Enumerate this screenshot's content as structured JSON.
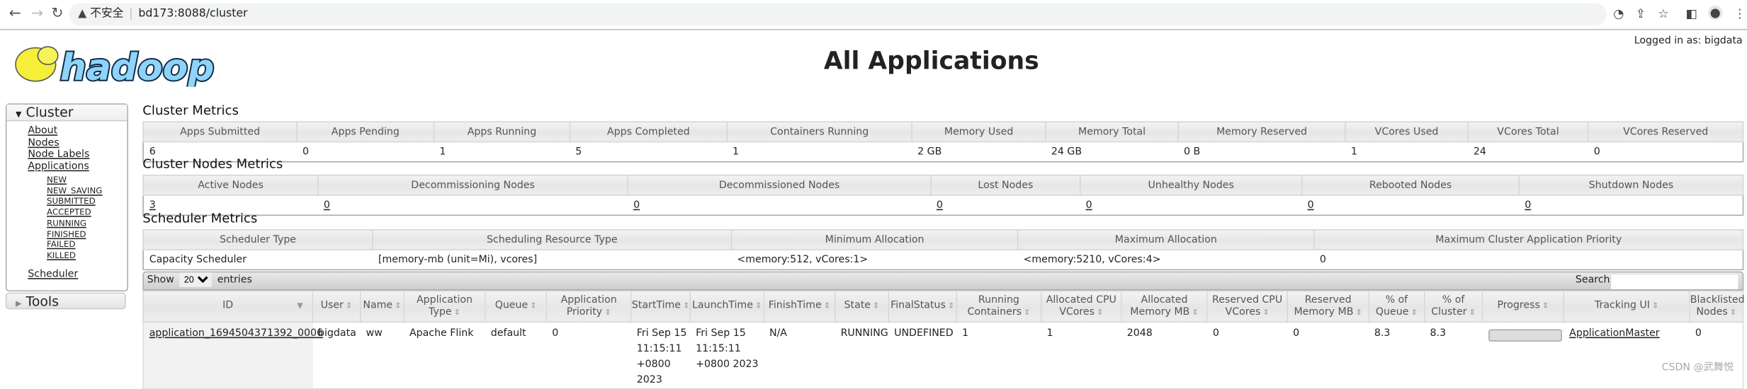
{
  "browser": {
    "security_label": "不安全",
    "url": "bd173:8088/cluster"
  },
  "header": {
    "logo_text": "hadoop",
    "title": "All Applications",
    "logged_in": "Logged in as: bigdata"
  },
  "sidebar": {
    "cluster_label": "Cluster",
    "links": [
      "About",
      "Nodes",
      "Node Labels",
      "Applications"
    ],
    "app_states": [
      "NEW",
      "NEW_SAVING",
      "SUBMITTED",
      "ACCEPTED",
      "RUNNING",
      "FINISHED",
      "FAILED",
      "KILLED"
    ],
    "scheduler": "Scheduler",
    "tools_label": "Tools"
  },
  "cluster_metrics": {
    "title": "Cluster Metrics",
    "headers": [
      "Apps Submitted",
      "Apps Pending",
      "Apps Running",
      "Apps Completed",
      "Containers Running",
      "Memory Used",
      "Memory Total",
      "Memory Reserved",
      "VCores Used",
      "VCores Total",
      "VCores Reserved"
    ],
    "values": [
      "6",
      "0",
      "1",
      "5",
      "1",
      "2 GB",
      "24 GB",
      "0 B",
      "1",
      "24",
      "0"
    ]
  },
  "node_metrics": {
    "title": "Cluster Nodes Metrics",
    "headers": [
      "Active Nodes",
      "Decommissioning Nodes",
      "Decommissioned Nodes",
      "Lost Nodes",
      "Unhealthy Nodes",
      "Rebooted Nodes",
      "Shutdown Nodes"
    ],
    "values": [
      "3",
      "0",
      "0",
      "0",
      "0",
      "0",
      "0"
    ]
  },
  "scheduler_metrics": {
    "title": "Scheduler Metrics",
    "headers": [
      "Scheduler Type",
      "Scheduling Resource Type",
      "Minimum Allocation",
      "Maximum Allocation",
      "Maximum Cluster Application Priority"
    ],
    "values": [
      "Capacity Scheduler",
      "[memory-mb (unit=Mi), vcores]",
      "<memory:512, vCores:1>",
      "<memory:5210, vCores:4>",
      "0"
    ]
  },
  "apps_table": {
    "show_label": "Show",
    "entries_value": "20",
    "entries_label": "entries",
    "search_label": "Search:",
    "search_value": "",
    "headers": [
      "ID",
      "User",
      "Name",
      "Application Type",
      "Queue",
      "Application Priority",
      "StartTime",
      "LaunchTime",
      "FinishTime",
      "State",
      "FinalStatus",
      "Running Containers",
      "Allocated CPU VCores",
      "Allocated Memory MB",
      "Reserved CPU VCores",
      "Reserved Memory MB",
      "% of Queue",
      "% of Cluster",
      "Progress",
      "Tracking UI",
      "Blacklisted Nodes"
    ],
    "rows": [
      {
        "id": "application_1694504371392_0006",
        "user": "bigdata",
        "name": "ww",
        "type": "Apache Flink",
        "queue": "default",
        "priority": "0",
        "start": "Fri Sep 15 11:15:11 +0800 2023",
        "launch": "Fri Sep 15 11:15:11 +0800 2023",
        "finish": "N/A",
        "state": "RUNNING",
        "final_status": "UNDEFINED",
        "running_containers": "1",
        "alloc_cpu": "1",
        "alloc_mem": "2048",
        "res_cpu": "0",
        "res_mem": "0",
        "pct_queue": "8.3",
        "pct_cluster": "8.3",
        "progress_percent": 0,
        "tracking": "ApplicationMaster",
        "blacklisted": "0"
      }
    ]
  },
  "watermark": "CSDN @武舞悦"
}
